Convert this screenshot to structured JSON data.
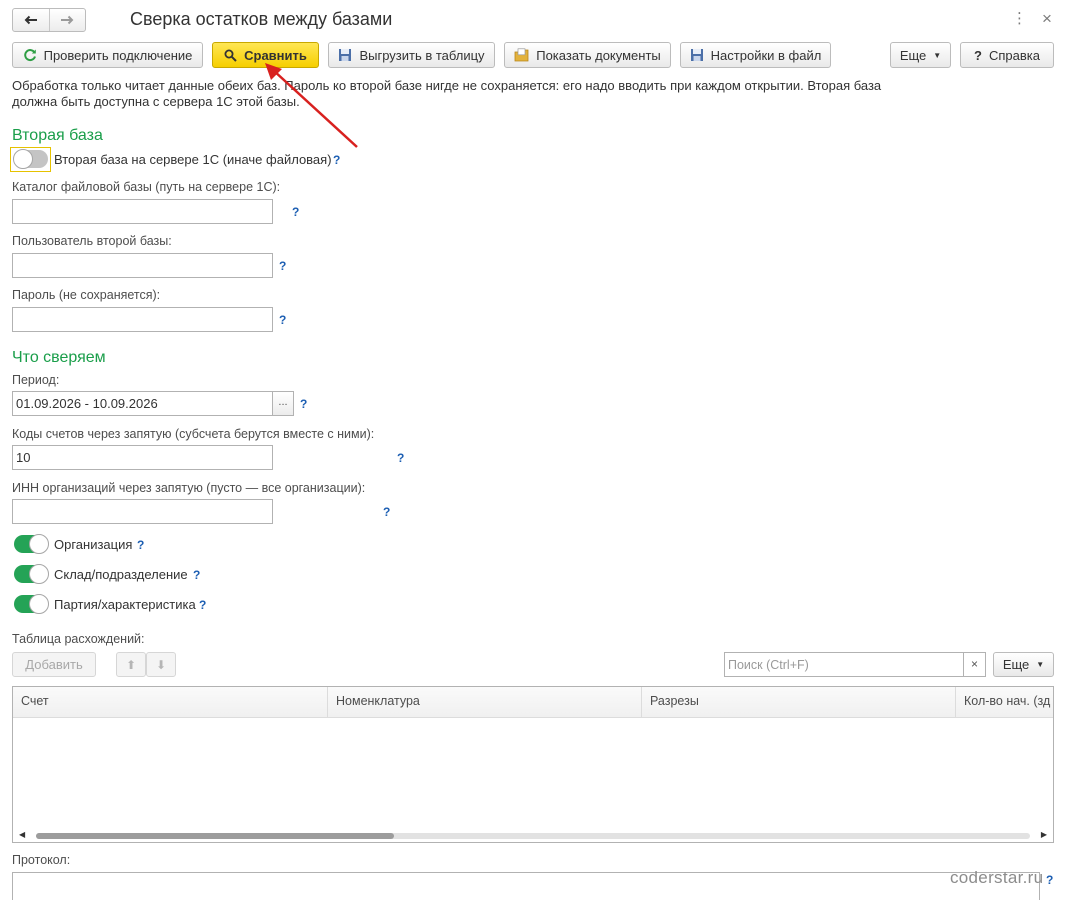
{
  "window": {
    "title": "Сверка остатков между базами",
    "menu_glyph": "⋮",
    "close_glyph": "×"
  },
  "nav": {
    "back_icon": "arrow-left-icon",
    "forward_icon": "arrow-right-icon"
  },
  "toolbar": {
    "check_connection": "Проверить подключение",
    "compare": "Сравнить",
    "export_table": "Выгрузить в таблицу",
    "show_documents": "Показать документы",
    "settings_to_file": "Настройки в файл",
    "more": "Еще",
    "help": "Справка",
    "help_glyph": "?"
  },
  "info": "Обработка только читает данные обеих баз. Пароль ко второй базе нигде не сохраняется: его надо вводить при каждом открытии. Вторая база должна быть доступна с сервера 1С этой базы.",
  "second_base": {
    "title": "Вторая база",
    "server_toggle": {
      "label": "Вторая база на сервере 1С (иначе файловая)",
      "on": false
    },
    "catalog": {
      "label": "Каталог файловой базы (путь на сервере 1С):",
      "value": ""
    },
    "user": {
      "label": "Пользователь второй базы:",
      "value": ""
    },
    "password": {
      "label": "Пароль (не сохраняется):",
      "value": ""
    }
  },
  "what_compare": {
    "title": "Что сверяем",
    "period": {
      "label": "Период:",
      "value": "01.09.2026 - 10.09.2026",
      "select_glyph": "..."
    },
    "accounts": {
      "label": "Коды счетов через запятую (субсчета берутся вместе с ними):",
      "value": "10"
    },
    "inn": {
      "label": "ИНН организаций через запятую (пусто — все организации):",
      "value": ""
    },
    "toggles": [
      {
        "label": "Организация",
        "on": true
      },
      {
        "label": "Склад/подразделение",
        "on": true
      },
      {
        "label": "Партия/характеристика",
        "on": true
      }
    ]
  },
  "help_mark": "?",
  "diff_table": {
    "label": "Таблица расхождений:",
    "add_button": "Добавить",
    "search_placeholder": "Поиск (Ctrl+F)",
    "clear_glyph": "×",
    "more": "Еще",
    "columns": [
      "Счет",
      "Номенклатура",
      "Разрезы",
      "Кол-во нач. (зд"
    ],
    "rows": []
  },
  "protocol": {
    "label": "Протокол:",
    "value": ""
  },
  "watermark": "coderstar.ru",
  "colors": {
    "accent_green": "#1a9e4a",
    "primary_yellow": "#f6cf00",
    "annotation_red": "#d8211f",
    "help_blue": "#1d5fb3"
  }
}
